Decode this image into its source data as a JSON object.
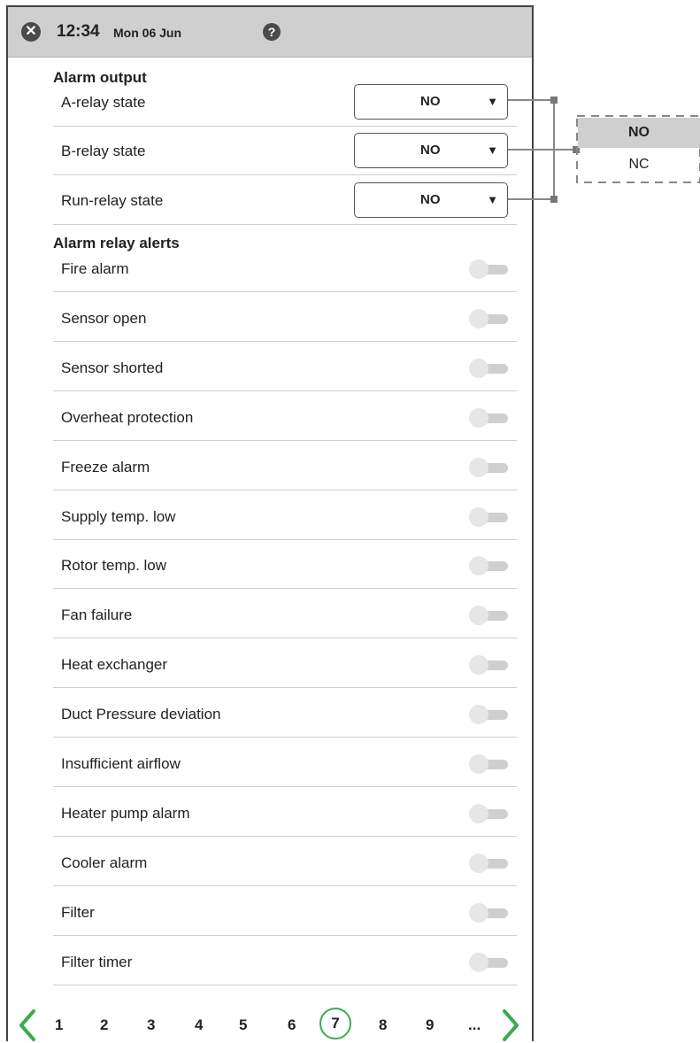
{
  "status_bar": {
    "time": "12:34",
    "date": "Mon 06 Jun",
    "close_icon": "✕",
    "help_icon": "?"
  },
  "alarm_output": {
    "title": "Alarm output",
    "rows": [
      {
        "label": "A-relay state",
        "value": "NO"
      },
      {
        "label": "B-relay state",
        "value": "NO"
      },
      {
        "label": "Run-relay state",
        "value": "NO"
      }
    ],
    "dropdown_arrow": "▼"
  },
  "alarm_relay_alerts": {
    "title": "Alarm relay alerts",
    "items": [
      {
        "label": "Fire alarm",
        "on": false
      },
      {
        "label": "Sensor open",
        "on": false
      },
      {
        "label": "Sensor shorted",
        "on": false
      },
      {
        "label": "Overheat protection",
        "on": false
      },
      {
        "label": "Freeze alarm",
        "on": false
      },
      {
        "label": "Supply temp. low",
        "on": false
      },
      {
        "label": "Rotor temp. low",
        "on": false
      },
      {
        "label": "Fan failure",
        "on": false
      },
      {
        "label": "Heat exchanger",
        "on": false
      },
      {
        "label": "Duct Pressure deviation",
        "on": false
      },
      {
        "label": "Insufficient airflow",
        "on": false
      },
      {
        "label": "Heater pump alarm",
        "on": false
      },
      {
        "label": "Cooler alarm",
        "on": false
      },
      {
        "label": "Filter",
        "on": false
      },
      {
        "label": "Filter timer",
        "on": false
      }
    ]
  },
  "relay_options_popup": {
    "options": [
      "NO",
      "NC"
    ],
    "selected": "NO"
  },
  "pagination": {
    "pages": [
      "1",
      "2",
      "3",
      "4",
      "5",
      "6",
      "7",
      "8",
      "9",
      "..."
    ],
    "current": "7"
  },
  "colors": {
    "accent": "#3aaa52",
    "status_bar": "#cfcfcf",
    "toggle_off": "#cfcfcf"
  }
}
